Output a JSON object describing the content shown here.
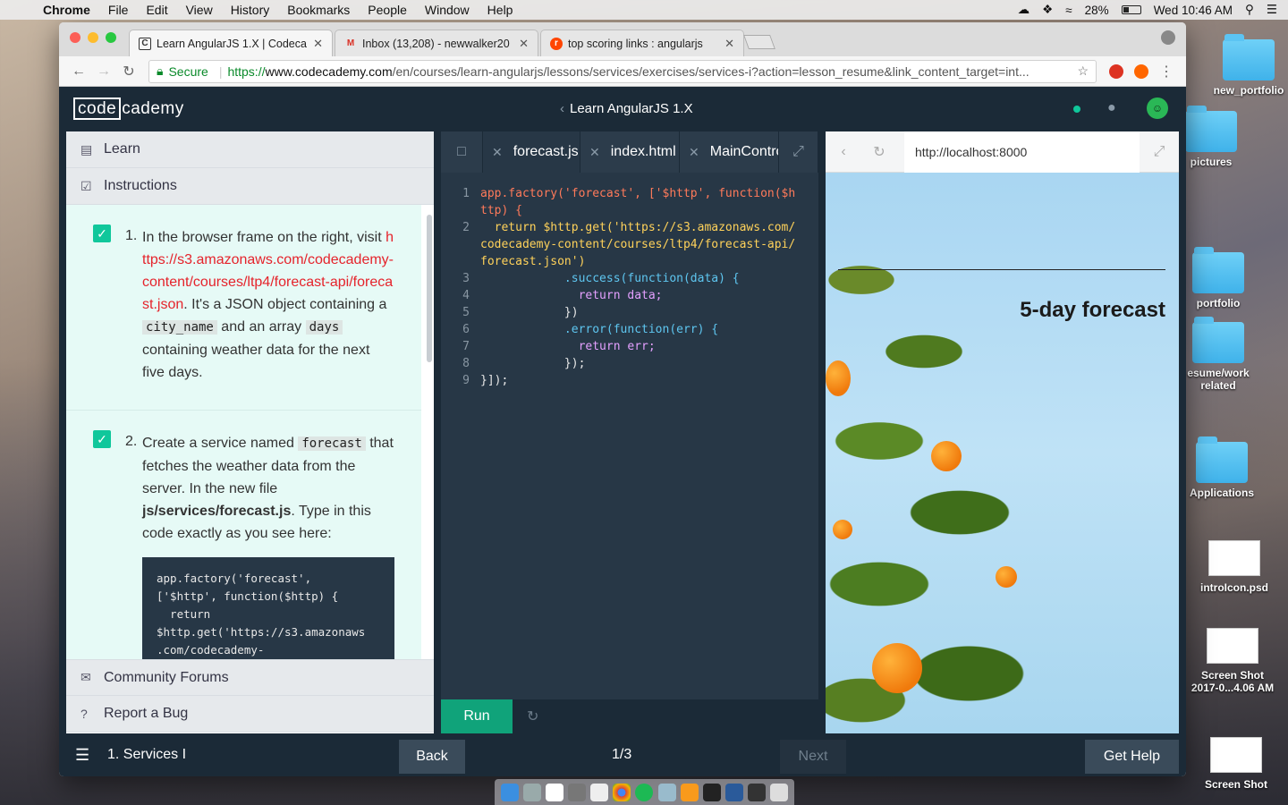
{
  "menubar": {
    "app": "Chrome",
    "items": [
      "File",
      "Edit",
      "View",
      "History",
      "Bookmarks",
      "People",
      "Window",
      "Help"
    ],
    "battery": "28%",
    "clock": "Wed 10:46 AM"
  },
  "desktop": {
    "icons": [
      {
        "label": "new_portfolio",
        "kind": "folder"
      },
      {
        "label": "pictures",
        "kind": "folder"
      },
      {
        "label": "portfolio",
        "kind": "folder"
      },
      {
        "label": "esume/work related",
        "kind": "folder"
      },
      {
        "label": "Applications",
        "kind": "folder"
      },
      {
        "label": "introIcon.psd",
        "kind": "file"
      },
      {
        "label": "Screen Shot 2017-0...4.06 AM",
        "kind": "file"
      },
      {
        "label": "Screen Shot",
        "kind": "file"
      }
    ]
  },
  "browser": {
    "tabs": [
      {
        "title": "Learn AngularJS 1.X | Codeca",
        "favicon": "C"
      },
      {
        "title": "Inbox (13,208) - newwalker20",
        "favicon": "M"
      },
      {
        "title": "top scoring links : angularjs",
        "favicon": "r"
      }
    ],
    "address": {
      "secure": "Secure",
      "scheme": "https://",
      "host": "www.codecademy.com",
      "path": "/en/courses/learn-angularjs/lessons/services/exercises/services-i?action=lesson_resume&link_content_target=int..."
    }
  },
  "codecademy": {
    "logo_code": "code",
    "logo_rest": "cademy",
    "course_title": "Learn AngularJS 1.X",
    "left_panel": {
      "learn": "Learn",
      "instructions": "Instructions",
      "steps": [
        {
          "num": "1.",
          "parts": [
            "In the browser frame on the right, visit ",
            "https://s3.amazonaws.com/codecademy-content/courses/ltp4/forecast-api/forecast.json",
            ". It's a JSON object containing a ",
            "city_name",
            " and an array ",
            "days",
            " containing weather data for the next five days."
          ]
        },
        {
          "num": "2.",
          "parts": [
            "Create a service named ",
            "forecast",
            " that fetches the weather data from the server. In the new file ",
            "js/services/forecast.js",
            ". Type in this code exactly as you see here:"
          ]
        }
      ],
      "snippet": [
        "app.factory('forecast',",
        "['$http', function($http) {",
        "  return",
        "$http.get('https://s3.amazonaws",
        ".com/codecademy-"
      ],
      "community": "Community Forums",
      "bug": "Report a Bug"
    },
    "editor": {
      "tabs": [
        "forecast.js",
        "index.html",
        "MainController.js"
      ],
      "lines": [
        {
          "n": "1",
          "code": "app.factory('forecast', ['$http', function($http) {"
        },
        {
          "n": "2",
          "code": "  return $http.get('https://s3.amazonaws.com/codecademy-content/courses/ltp4/forecast-api/forecast.json')"
        },
        {
          "n": "3",
          "code": "            .success(function(data) {"
        },
        {
          "n": "4",
          "code": "              return data;"
        },
        {
          "n": "5",
          "code": "            })"
        },
        {
          "n": "6",
          "code": "            .error(function(err) {"
        },
        {
          "n": "7",
          "code": "              return err;"
        },
        {
          "n": "8",
          "code": "            });"
        },
        {
          "n": "9",
          "code": "}]);"
        }
      ],
      "run": "Run"
    },
    "preview": {
      "url": "http://localhost:8000",
      "heading": "5-day forecast"
    },
    "footer": {
      "lesson": "1. Services I",
      "back": "Back",
      "pager": "1/3",
      "next": "Next",
      "help": "Get Help"
    }
  }
}
